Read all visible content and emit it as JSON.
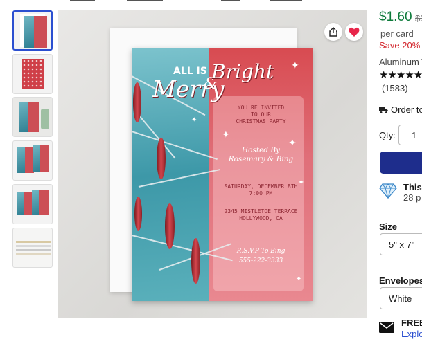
{
  "product": {
    "price": "$1.60",
    "old_price": "$3",
    "unit": "per card",
    "save": "Save 20% o",
    "material": "Aluminum T",
    "rating_stars": 5,
    "stars_glyphs": "★★★★★",
    "review_count": "(1583)"
  },
  "shipping": {
    "order_text": "Order to"
  },
  "quantity": {
    "label": "Qty:",
    "value": "1"
  },
  "promo": {
    "line1": "This",
    "line2": "28 p"
  },
  "size": {
    "label": "Size",
    "value": "5\" x 7\""
  },
  "envelopes": {
    "label": "Envelopes",
    "value": "White"
  },
  "delivery": {
    "line1": "FREE",
    "line2": "Explo"
  },
  "card": {
    "all_is": "ALL IS",
    "merry": "Merry",
    "amp": "&",
    "bright": "Bright",
    "invite_lines": [
      "YOU'RE INVITED",
      "TO OUR",
      "CHRISTMAS PARTY"
    ],
    "hosted_lines": [
      "Hosted By",
      "Rosemary & Bing"
    ],
    "date_lines": [
      "SATURDAY, DECEMBER 8TH",
      "7:00 PM"
    ],
    "address_lines": [
      "2345 MISTLETOE TERRACE",
      "HOLLYWOOD, CA"
    ],
    "rsvp_lines": [
      "R.S.V.P To Bing",
      "555-222-3333"
    ]
  },
  "colors": {
    "price_green": "#0d7a3a",
    "save_red": "#d2232a",
    "brand_navy": "#1e2d8c",
    "favorite_red": "#e8264a",
    "selected_thumb_border": "#2b4fd0"
  },
  "icons": {
    "share": "share-icon",
    "favorite": "heart-icon",
    "truck": "truck-icon",
    "diamond": "diamond-icon",
    "mail": "mail-icon"
  }
}
